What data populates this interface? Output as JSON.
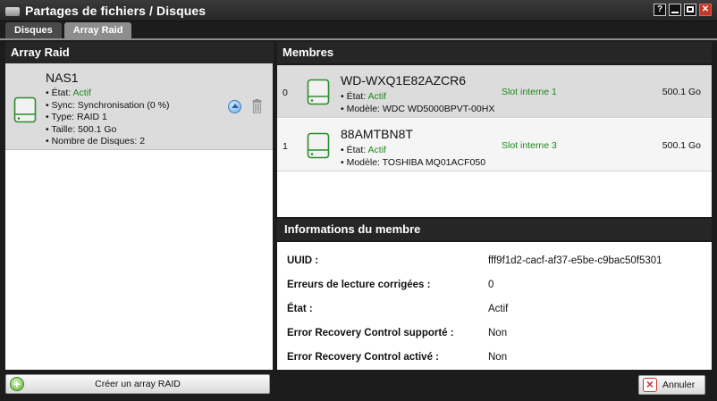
{
  "window": {
    "title": "Partages de fichiers / Disques",
    "help_label": "?",
    "close_label": "✕"
  },
  "tabs": [
    {
      "label": "Disques",
      "active": false
    },
    {
      "label": "Array Raid",
      "active": true
    }
  ],
  "left_panel": {
    "header": "Array Raid",
    "raid": {
      "name": "NAS1",
      "state_label": "• État:",
      "state_value": "Actif",
      "sync": "• Sync: Synchronisation (0 %)",
      "type": "• Type: RAID 1",
      "size": "• Taille: 500.1 Go",
      "disk_count": "• Nombre de Disques: 2",
      "icons": [
        "eject-icon",
        "trash-icon",
        "hard-drive-icon"
      ]
    },
    "create_button": "Créer un array RAID"
  },
  "members": {
    "header": "Membres",
    "rows": [
      {
        "index": "0",
        "name": "WD-WXQ1E82AZCR6",
        "state_label": "• État:",
        "state_value": "Actif",
        "model": "• Modèle: WDC WD5000BPVT-00HX",
        "slot": "Slot interne 1",
        "size": "500.1 Go"
      },
      {
        "index": "1",
        "name": "88AMTBN8T",
        "state_label": "• État:",
        "state_value": "Actif",
        "model": "• Modèle: TOSHIBA MQ01ACF050",
        "slot": "Slot interne 3",
        "size": "500.1 Go"
      }
    ]
  },
  "member_info": {
    "header": "Informations du membre",
    "rows": [
      {
        "label": "UUID :",
        "value": "fff9f1d2-cacf-af37-e5be-c9bac50f5301"
      },
      {
        "label": "Erreurs de lecture corrigées :",
        "value": "0"
      },
      {
        "label": "État :",
        "value": "Actif"
      },
      {
        "label": "Error Recovery Control supporté :",
        "value": "Non"
      },
      {
        "label": "Error Recovery Control activé :",
        "value": "Non"
      }
    ]
  },
  "footer": {
    "cancel_button": "Annuler"
  },
  "colors": {
    "status_green": "#1a8a1a",
    "panel_dark": "#262626",
    "selected_row": "#dcdcdc"
  }
}
